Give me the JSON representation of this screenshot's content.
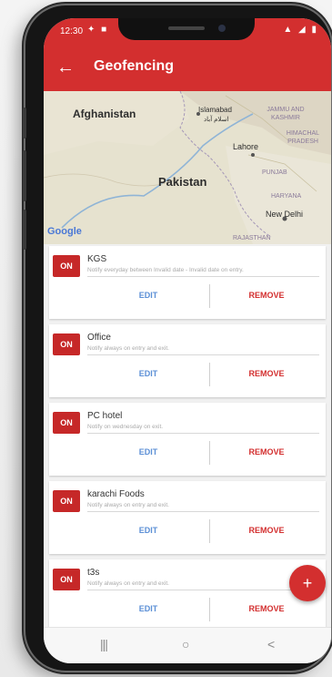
{
  "status_bar": {
    "time": "12:30",
    "left_icons": "✦ ■",
    "right_icons": "▲ ◢ ▮"
  },
  "app_bar": {
    "title": "Geofencing"
  },
  "map": {
    "labels": [
      "Afghanistan",
      "Islamabad",
      "اسلام آباد",
      "JAMMU AND KASHMIR",
      "HIMACHAL PRADESH",
      "Lahore",
      "PUNJAB",
      "Pakistan",
      "HARYANA",
      "New Delhi",
      "RAJASTHAN"
    ],
    "attribution": "Google"
  },
  "geofences": [
    {
      "name": "KGS",
      "description": "Notify everyday between Invalid date - Invalid date on entry.",
      "toggle": "ON"
    },
    {
      "name": "Office",
      "description": "Notify always on entry and exit.",
      "toggle": "ON"
    },
    {
      "name": "PC hotel",
      "description": "Notify on wednesday on exit.",
      "toggle": "ON"
    },
    {
      "name": "karachi Foods",
      "description": "Notify always on entry and exit.",
      "toggle": "ON"
    },
    {
      "name": "t3s",
      "description": "Notify always on entry and exit.",
      "toggle": "ON"
    }
  ],
  "actions": {
    "edit": "EDIT",
    "remove": "REMOVE"
  },
  "fab": {
    "icon": "+"
  },
  "nav": {
    "recent": "|||",
    "home": "○",
    "back": "<"
  },
  "colors": {
    "primary": "#d32f2f",
    "edit": "#5b8fd6"
  }
}
